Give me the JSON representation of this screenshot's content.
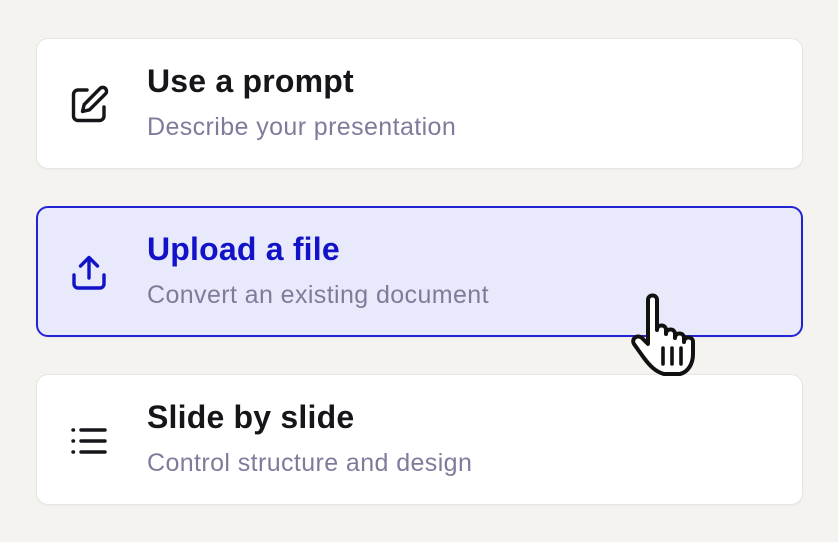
{
  "options": [
    {
      "title": "Use a prompt",
      "subtitle": "Describe your presentation",
      "icon": "edit-icon",
      "selected": false
    },
    {
      "title": "Upload a file",
      "subtitle": "Convert an existing document",
      "icon": "upload-icon",
      "selected": true
    },
    {
      "title": "Slide by slide",
      "subtitle": "Control structure and design",
      "icon": "list-icon",
      "selected": false
    }
  ],
  "colors": {
    "background": "#f4f3ef",
    "card": "#ffffff",
    "selected_bg": "#e8e9fb",
    "selected_border": "#2323d6",
    "selected_text": "#1212c9",
    "title_text": "#16161a",
    "subtitle_text": "#7f7c9b"
  },
  "cursor": {
    "icon": "hand-pointer-cursor-icon"
  }
}
